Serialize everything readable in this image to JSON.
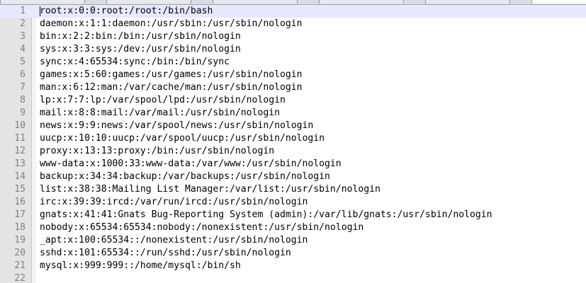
{
  "editor": {
    "lines": [
      "root:x:0:0:root:/root:/bin/bash",
      "daemon:x:1:1:daemon:/usr/sbin:/usr/sbin/nologin",
      "bin:x:2:2:bin:/bin:/usr/sbin/nologin",
      "sys:x:3:3:sys:/dev:/usr/sbin/nologin",
      "sync:x:4:65534:sync:/bin:/bin/sync",
      "games:x:5:60:games:/usr/games:/usr/sbin/nologin",
      "man:x:6:12:man:/var/cache/man:/usr/sbin/nologin",
      "lp:x:7:7:lp:/var/spool/lpd:/usr/sbin/nologin",
      "mail:x:8:8:mail:/var/mail:/usr/sbin/nologin",
      "news:x:9:9:news:/var/spool/news:/usr/sbin/nologin",
      "uucp:x:10:10:uucp:/var/spool/uucp:/usr/sbin/nologin",
      "proxy:x:13:13:proxy:/bin:/usr/sbin/nologin",
      "www-data:x:1000:33:www-data:/var/www:/usr/sbin/nologin",
      "backup:x:34:34:backup:/var/backups:/usr/sbin/nologin",
      "list:x:38:38:Mailing List Manager:/var/list:/usr/sbin/nologin",
      "irc:x:39:39:ircd:/var/run/ircd:/usr/sbin/nologin",
      "gnats:x:41:41:Gnats Bug-Reporting System (admin):/var/lib/gnats:/usr/sbin/nologin",
      "nobody:x:65534:65534:nobody:/nonexistent:/usr/sbin/nologin",
      "_apt:x:100:65534::/nonexistent:/usr/sbin/nologin",
      "sshd:x:101:65534::/run/sshd:/usr/sbin/nologin",
      "mysql:x:999:999::/home/mysql:/bin/sh",
      ""
    ],
    "current_line": 1,
    "colors": {
      "current_line_bg": "#e8e8ff",
      "gutter_bg": "#e4e4e4",
      "line_number": "#808080",
      "text": "#000000"
    }
  }
}
